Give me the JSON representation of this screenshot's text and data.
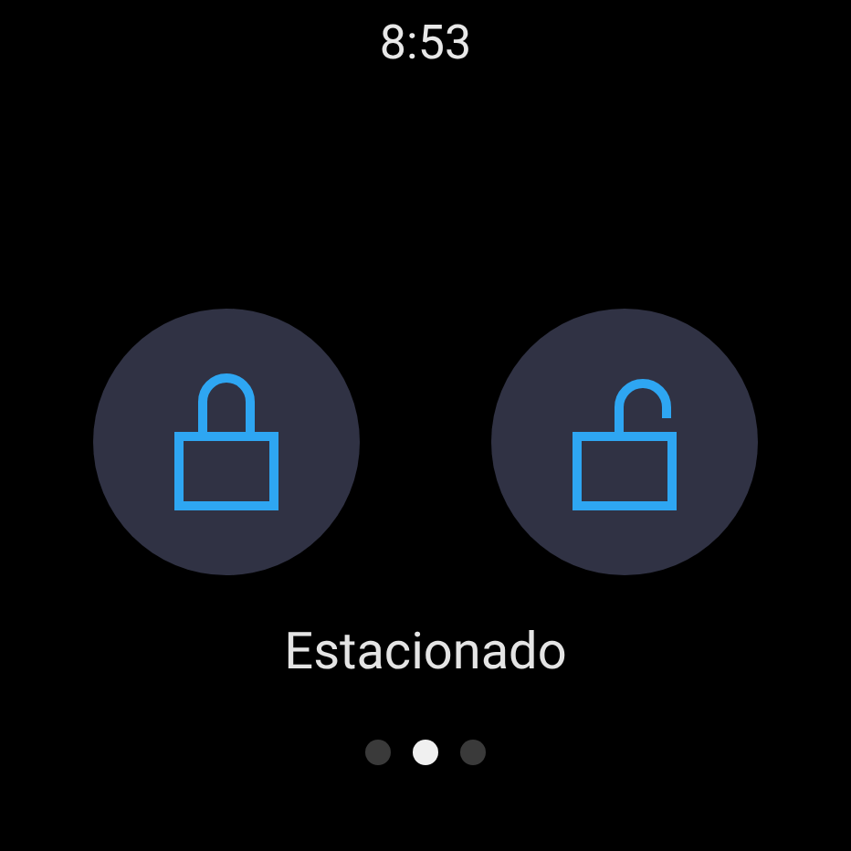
{
  "time": "8:53",
  "buttons": [
    {
      "kind": "lock"
    },
    {
      "kind": "unlock"
    }
  ],
  "status": "Estacionado",
  "page_dots": [
    {
      "selected": false
    },
    {
      "selected": true
    },
    {
      "selected": false
    }
  ]
}
